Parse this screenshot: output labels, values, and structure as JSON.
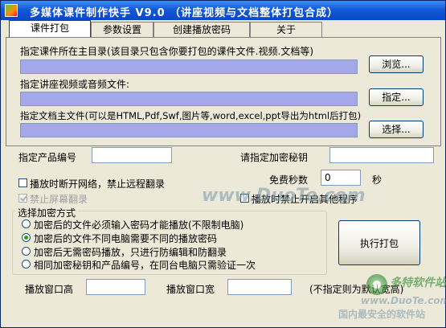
{
  "window": {
    "title": "多媒体课件制作快手 V9.0 （讲座视频与文档整体打包合成）"
  },
  "tabs": [
    {
      "label": "课件打包",
      "active": true
    },
    {
      "label": "参数设置",
      "active": false
    },
    {
      "label": "创建播放密码",
      "active": false
    },
    {
      "label": "关于",
      "active": false
    }
  ],
  "packaging": {
    "dir_label": "指定课件所在主目录(该目录只包含你要打包的课件文件.视频.文档等)",
    "dir_value": "",
    "browse_button": "浏览...",
    "media_label": "指定讲座视频或音频文件:",
    "media_value": "",
    "specify_button": "指定...",
    "doc_label": "指定文档主文件(可以是HTML,Pdf,Swf,图片等,word,excel,ppt导出为html后打包)",
    "doc_value": "",
    "select_button": "选择..."
  },
  "settings": {
    "product_id_label": "指定产品编号",
    "product_id_value": "",
    "secret_key_label": "请指定加密秘钥",
    "secret_key_value": "",
    "disconnect_label": "播放时断开网络，禁止远程翻录",
    "disconnect_checked": false,
    "free_seconds_label": "免费秒数",
    "free_seconds_value": "0",
    "seconds_unit": "秒",
    "block_capture_label": "禁止屏幕翻录",
    "block_capture_checked": true,
    "block_capture_enabled": false,
    "block_other_label": "播放时禁止开启其他程序",
    "block_other_checked": false
  },
  "encryption": {
    "group_title": "选择加密方式",
    "options": [
      {
        "label": "加密后的文件必须输入密码才能播放(不限制电脑)",
        "selected": false
      },
      {
        "label": "加密后的文件不同电脑需要不同的播放密码",
        "selected": true
      },
      {
        "label": "加密后无需密码播放，只进行防编辑和防翻录",
        "selected": false
      },
      {
        "label": "相同加密秘钥和产品编号，在同台电脑只需验证一次",
        "selected": false
      }
    ],
    "execute_button": "执行打包"
  },
  "window_size": {
    "height_label": "播放窗口高",
    "height_value": "",
    "width_label": "播放窗口宽",
    "width_value": "",
    "note": "(不指定则为默认宽高)"
  },
  "watermark": {
    "center": "www.DuoTe.com",
    "corner_brand": "多特软件站",
    "corner_url": "www.DuoTe.com",
    "corner_slogan": "国内最安全的软件站"
  },
  "colors": {
    "titlebar": "#0a47c7",
    "path_field": "#a4a8e8",
    "background": "#ece9d8"
  }
}
